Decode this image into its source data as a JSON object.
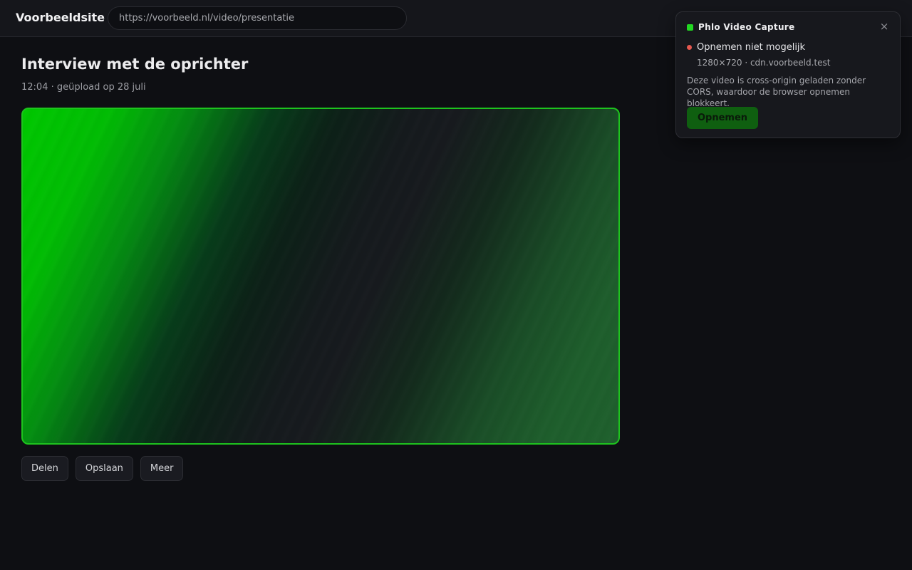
{
  "header": {
    "site_name": "Voorbeeldsite",
    "url": "https://voorbeeld.nl/video/presentatie"
  },
  "main": {
    "title": "Interview met de oprichter",
    "meta": "12:04 · geüpload op 28 juli",
    "actions": {
      "share_label": "Delen",
      "save_label": "Opslaan",
      "more_label": "Meer"
    }
  },
  "extension": {
    "name": "Phlo Video Capture",
    "close_symbol": "×",
    "status": "Opnemen niet mogelijk",
    "source": "1280×720 · cdn.voorbeeld.test",
    "description": "Deze video is cross-origin geladen zonder CORS, waardoor de browser opnemen blokkeert.",
    "record_label": "Opnemen",
    "colors": {
      "accent": "#22d822",
      "status_error": "#e5584f",
      "button_disabled": "#0f5f10"
    }
  },
  "icons": {
    "close": "close-icon",
    "status": "status-dot-icon",
    "logo": "logo-icon"
  }
}
